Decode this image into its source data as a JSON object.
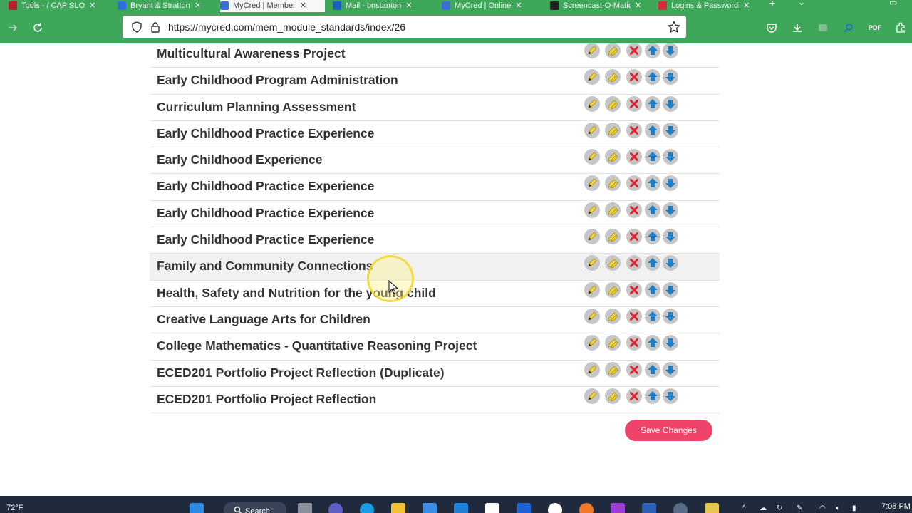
{
  "browser": {
    "tabs": [
      {
        "label": "Tools - / CAP SLO",
        "color": "#b21f2d",
        "active": false
      },
      {
        "label": "Bryant & Stratton",
        "color": "#2f6fdc",
        "active": false
      },
      {
        "label": "MyCred | Member",
        "color": "#3b6fd1",
        "active": true
      },
      {
        "label": "Mail - bnstanton",
        "color": "#1f5fbf",
        "active": false
      },
      {
        "label": "MyCred | Online",
        "color": "#3b6fd1",
        "active": false
      },
      {
        "label": "Screencast-O-Matic",
        "color": "#222222",
        "active": false
      },
      {
        "label": "Logins & Passwords",
        "color": "#d62b3a",
        "active": false
      }
    ],
    "url": "https://mycred.com/mem_module_standards/index/26"
  },
  "modules": [
    {
      "title": "Multicultural Awareness Project"
    },
    {
      "title": "Early Childhood Program Administration"
    },
    {
      "title": "Curriculum Planning Assessment"
    },
    {
      "title": "Early Childhood Practice Experience"
    },
    {
      "title": "Early Childhood Experience"
    },
    {
      "title": "Early Childhood Practice Experience"
    },
    {
      "title": "Early Childhood Practice Experience"
    },
    {
      "title": "Early Childhood Practice Experience"
    },
    {
      "title": "Family and Community Connections"
    },
    {
      "title": "Health, Safety and Nutrition for the young child"
    },
    {
      "title": "Creative Language Arts for Children"
    },
    {
      "title": "College Mathematics - Quantitative Reasoning Project"
    },
    {
      "title": "ECED201 Portfolio Project Reflection (Duplicate)"
    },
    {
      "title": "ECED201 Portfolio Project Reflection"
    }
  ],
  "highlighted_row": 8,
  "row_actions": [
    "edit-icon",
    "edit-standards-icon",
    "delete-icon",
    "move-up-icon",
    "move-down-icon"
  ],
  "save_button": {
    "label": "Save Changes"
  },
  "colors": {
    "browser_green": "#3fa75a",
    "save_button": "#f0436a",
    "delete_red": "#d9232e",
    "arrow_blue": "#1f7fc6",
    "pencil_yellow": "#f2d53c"
  },
  "taskbar": {
    "weather": "72°F",
    "search_label": "Search",
    "time": "7:08 PM"
  }
}
